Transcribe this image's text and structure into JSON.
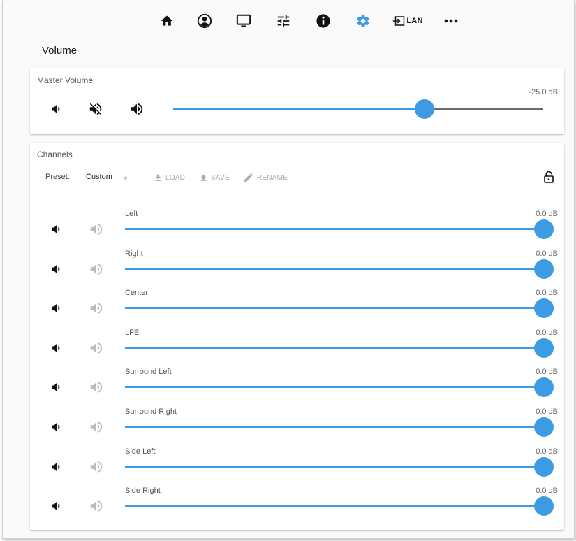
{
  "nav": {
    "lan_label": "LAN"
  },
  "colors": {
    "accent": "#3d9be3",
    "track": "#6b6b6b",
    "icon_active": "#111111",
    "icon_disabled": "#bbbbbb"
  },
  "page": {
    "title": "Volume"
  },
  "master": {
    "title": "Master Volume",
    "value_text": "-25.0  dB",
    "level_fraction": 0.68
  },
  "channels": {
    "title": "Channels",
    "preset_label": "Preset:",
    "preset_value": "Custom",
    "load_label": "LOAD",
    "save_label": "SAVE",
    "rename_label": "RENAME",
    "items": [
      {
        "label": "Left",
        "value_text": "0.0  dB",
        "level_fraction": 1.0
      },
      {
        "label": "Right",
        "value_text": "0.0  dB",
        "level_fraction": 1.0
      },
      {
        "label": "Center",
        "value_text": "0.0  dB",
        "level_fraction": 1.0
      },
      {
        "label": "LFE",
        "value_text": "0.0  dB",
        "level_fraction": 1.0
      },
      {
        "label": "Surround Left",
        "value_text": "0.0  dB",
        "level_fraction": 1.0
      },
      {
        "label": "Surround Right",
        "value_text": "0.0  dB",
        "level_fraction": 1.0
      },
      {
        "label": "Side Left",
        "value_text": "0.0  dB",
        "level_fraction": 1.0
      },
      {
        "label": "Side Right",
        "value_text": "0.0  dB",
        "level_fraction": 1.0
      }
    ]
  }
}
